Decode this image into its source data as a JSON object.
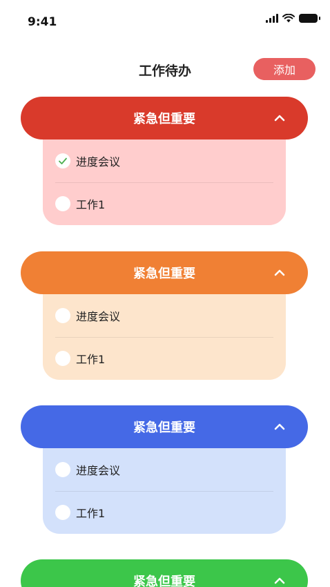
{
  "status_bar": {
    "time": "9:41"
  },
  "header": {
    "title": "工作待办",
    "add_label": "添加"
  },
  "colors": {
    "red": "#d93a2b",
    "orange": "#f08034",
    "blue": "#4569e6",
    "green": "#3cc64a",
    "red_body": "#ffcdcd",
    "orange_body": "#fde5cc",
    "blue_body": "#d3e1fb",
    "check": "#4caf50"
  },
  "groups": [
    {
      "title": "紧急但重要",
      "items": [
        {
          "label": "进度会议",
          "checked": true
        },
        {
          "label": "工作1",
          "checked": false
        }
      ]
    },
    {
      "title": "紧急但重要",
      "items": [
        {
          "label": "进度会议",
          "checked": false
        },
        {
          "label": "工作1",
          "checked": false
        }
      ]
    },
    {
      "title": "紧急但重要",
      "items": [
        {
          "label": "进度会议",
          "checked": false
        },
        {
          "label": "工作1",
          "checked": false
        }
      ]
    },
    {
      "title": "紧急但重要",
      "items": []
    }
  ]
}
